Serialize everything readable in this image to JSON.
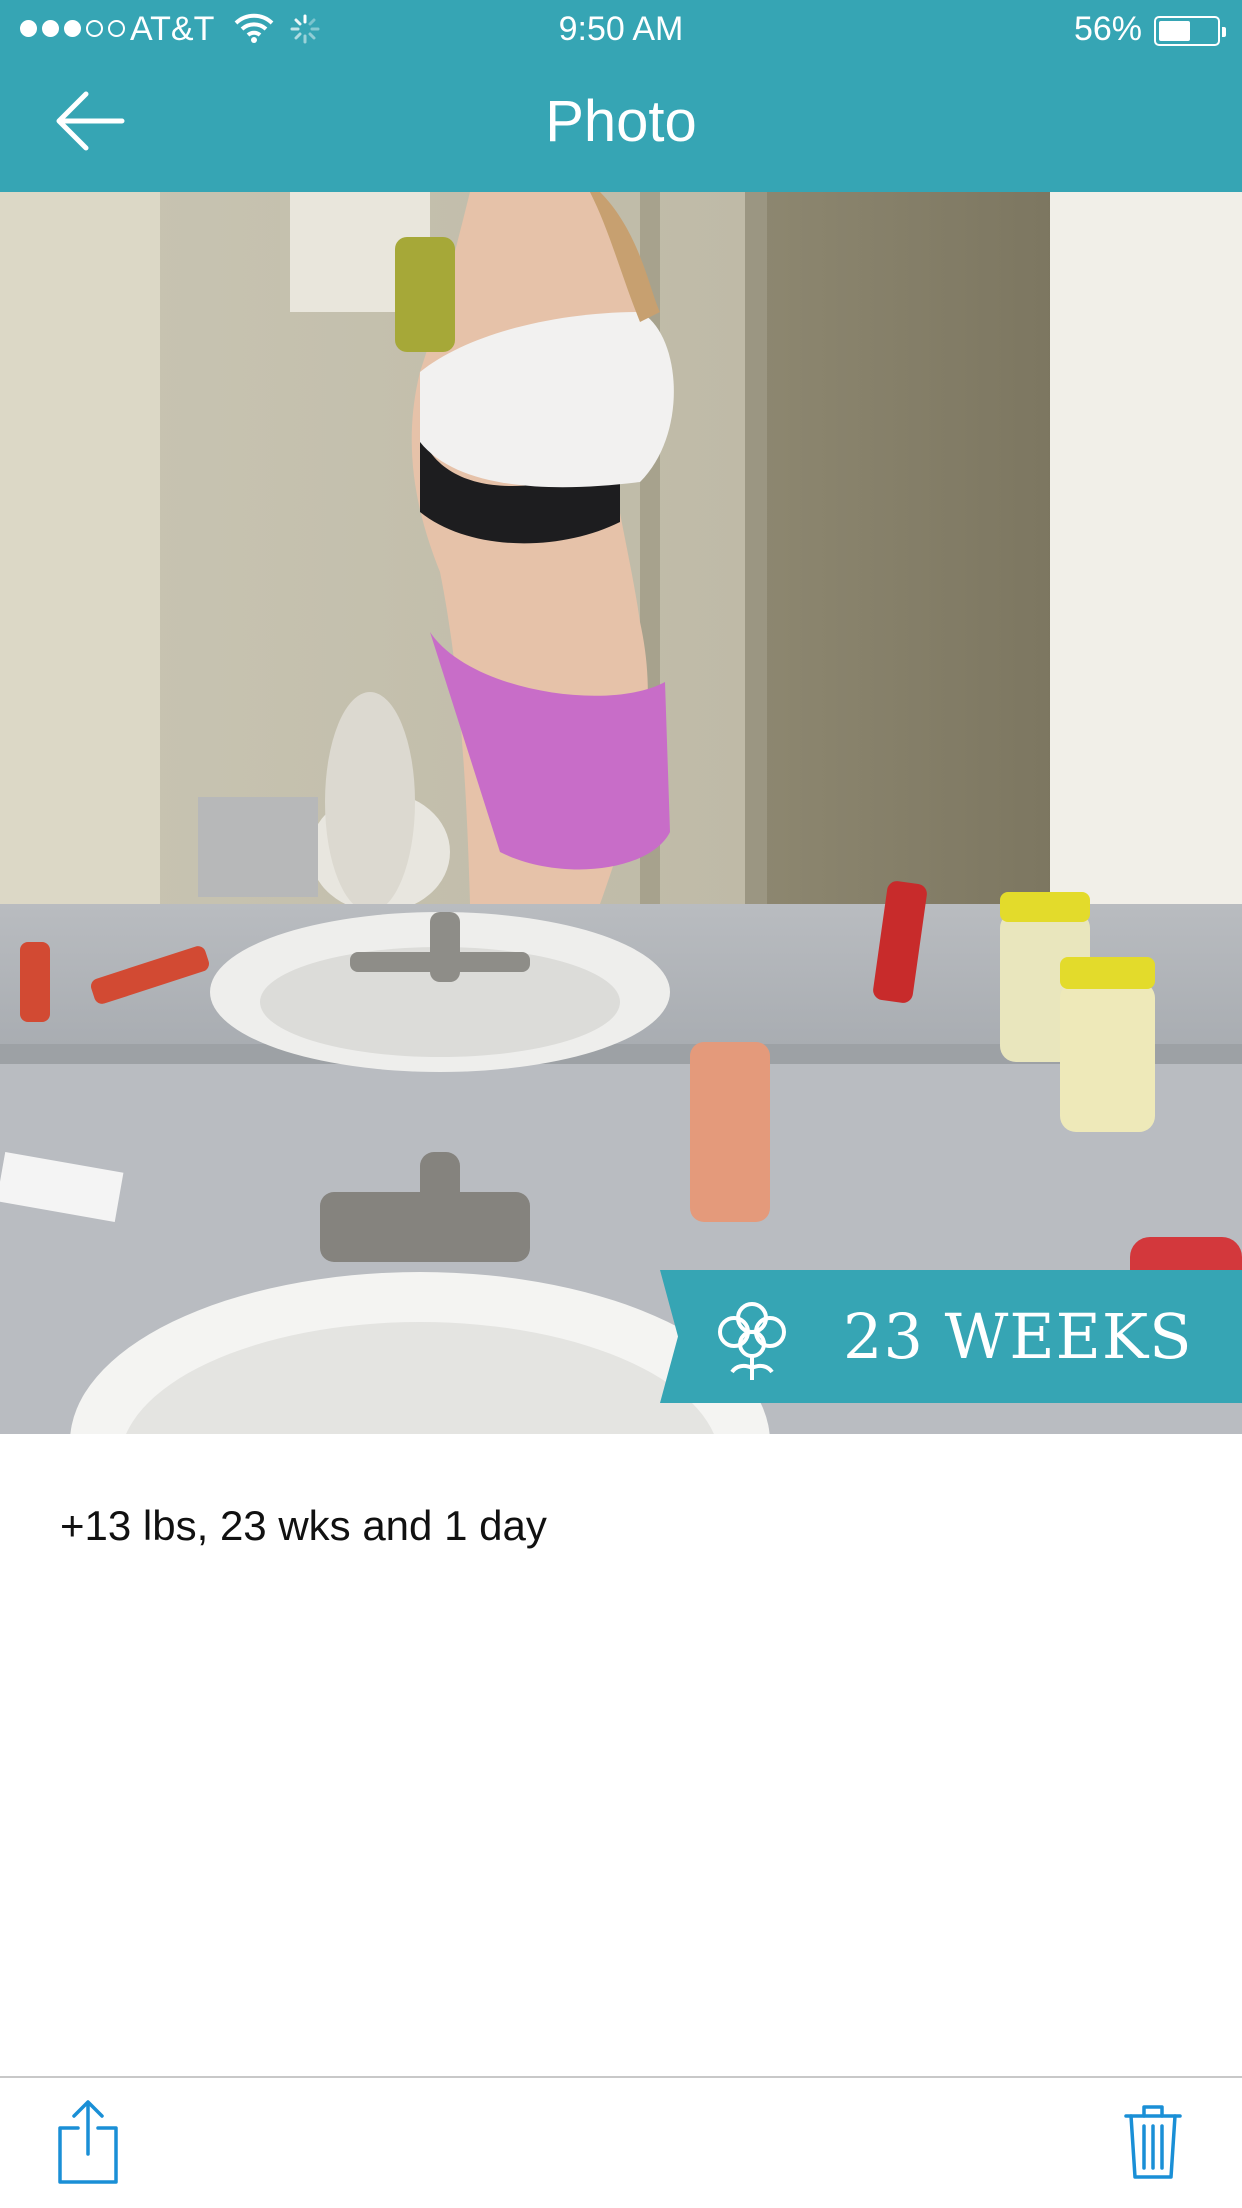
{
  "status_bar": {
    "carrier": "AT&T",
    "signal_bars_filled": 3,
    "signal_bars_total": 5,
    "time": "9:50 AM",
    "battery_percent_text": "56%",
    "battery_level": 0.56
  },
  "nav": {
    "title": "Photo",
    "back_icon": "arrow-left-icon"
  },
  "photo": {
    "badge_text": "23 WEEKS",
    "badge_icon": "flower-icon"
  },
  "caption": "+13 lbs, 23 wks and 1 day",
  "toolbar": {
    "share_icon": "share-icon",
    "delete_icon": "trash-icon"
  },
  "colors": {
    "accent": "#36a5b4",
    "toolbar_icon": "#1a8fd6"
  }
}
